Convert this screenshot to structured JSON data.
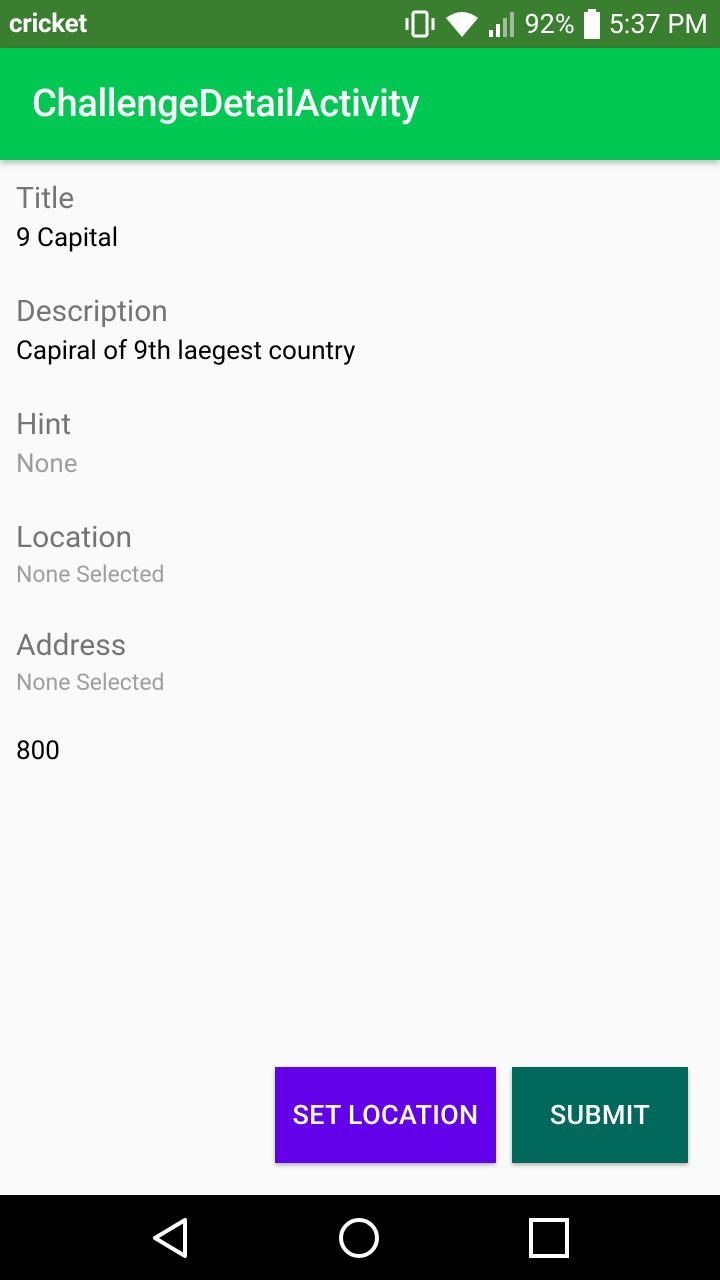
{
  "status_bar": {
    "carrier": "cricket",
    "battery": "92%",
    "time": "5:37 PM"
  },
  "app_bar": {
    "title": "ChallengeDetailActivity"
  },
  "fields": {
    "title": {
      "label": "Title",
      "value": "9 Capital"
    },
    "description": {
      "label": "Description",
      "value": "Capiral of 9th laegest country"
    },
    "hint": {
      "label": "Hint",
      "value": "None"
    },
    "location": {
      "label": "Location",
      "value": "None Selected"
    },
    "address": {
      "label": "Address",
      "value": "None Selected"
    }
  },
  "points": "800",
  "buttons": {
    "set_location": "SET LOCATION",
    "submit": "SUBMIT"
  },
  "colors": {
    "status_bar": "#3a7f2f",
    "app_bar": "#00c853",
    "set_location_button": "#6200ea",
    "submit_button": "#00695c"
  },
  "nav_icons": [
    "back-icon",
    "home-icon",
    "recents-icon"
  ]
}
